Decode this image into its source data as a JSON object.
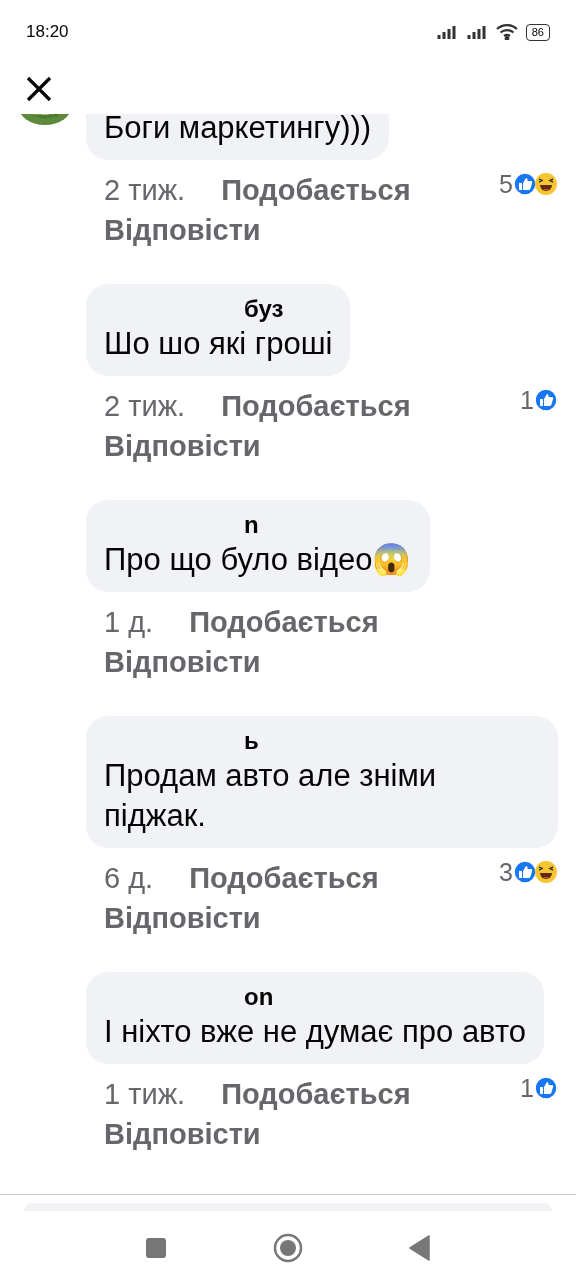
{
  "status_bar": {
    "time": "18:20",
    "battery": "86"
  },
  "comments": [
    {
      "text": "Боги маркетингу)))",
      "time": "2 тиж.",
      "like_label": "Подобається",
      "reply_label": "Відповісти",
      "reactions": {
        "count": "5",
        "like": true,
        "haha": true
      },
      "clipped": true
    },
    {
      "author": "буз",
      "text": "Шо шо які гроші",
      "time": "2 тиж.",
      "like_label": "Подобається",
      "reply_label": "Відповісти",
      "reactions": {
        "count": "1",
        "like": true,
        "haha": false
      }
    },
    {
      "author": "n",
      "text": "Про що було відео😱",
      "time": "1 д.",
      "like_label": "Подобається",
      "reply_label": "Відповісти"
    },
    {
      "author": "ь",
      "text": "Продам авто але зніми піджак.",
      "time": "6 д.",
      "like_label": "Подобається",
      "reply_label": "Відповісти",
      "reactions": {
        "count": "3",
        "like": true,
        "haha": true
      }
    },
    {
      "author": "on",
      "text": "І ніхто вже не думає про авто",
      "time": "1 тиж.",
      "like_label": "Подобається",
      "reply_label": "Відповісти",
      "reactions": {
        "count": "1",
        "like": true,
        "haha": false
      }
    }
  ]
}
